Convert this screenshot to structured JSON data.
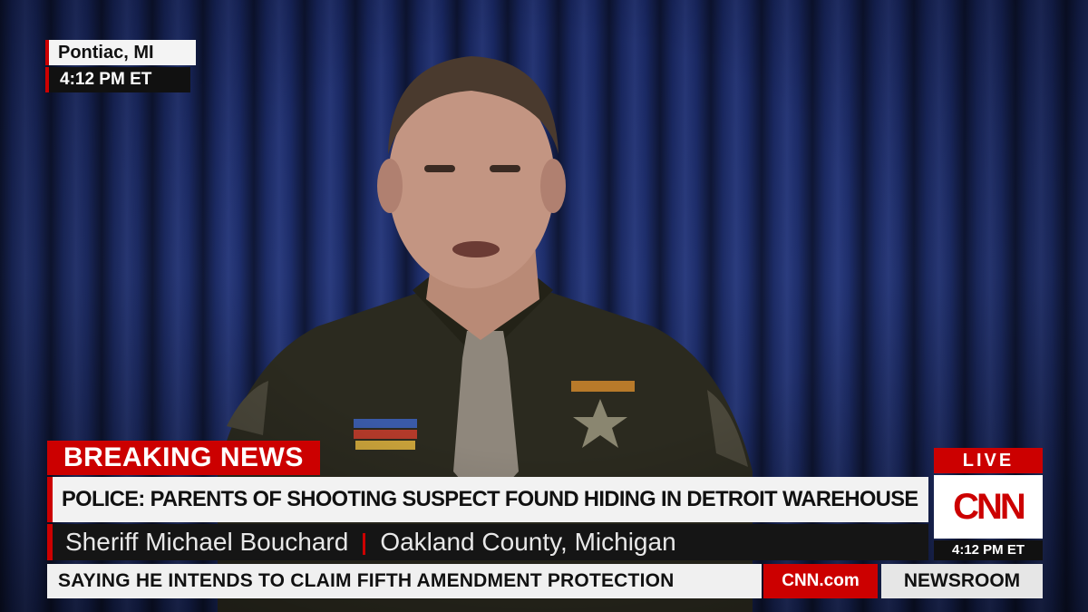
{
  "location": {
    "city": "Pontiac, MI",
    "time": "4:12 PM ET"
  },
  "banner": {
    "label": "BREAKING NEWS"
  },
  "headline": "POLICE: PARENTS OF SHOOTING SUSPECT FOUND HIDING IN DETROIT WAREHOUSE",
  "id_line": {
    "name": "Sheriff Michael Bouchard",
    "affiliation": "Oakland County, Michigan"
  },
  "ticker": "SAYING HE INTENDS TO CLAIM FIFTH AMENDMENT PROTECTION",
  "site": "CNN.com",
  "show": "NEWSROOM",
  "live_bug": {
    "label": "LIVE",
    "logo": "CNN",
    "time": "4:12 PM ET"
  },
  "colors": {
    "cnn_red": "#cc0000",
    "curtain_blue": "#223479"
  }
}
